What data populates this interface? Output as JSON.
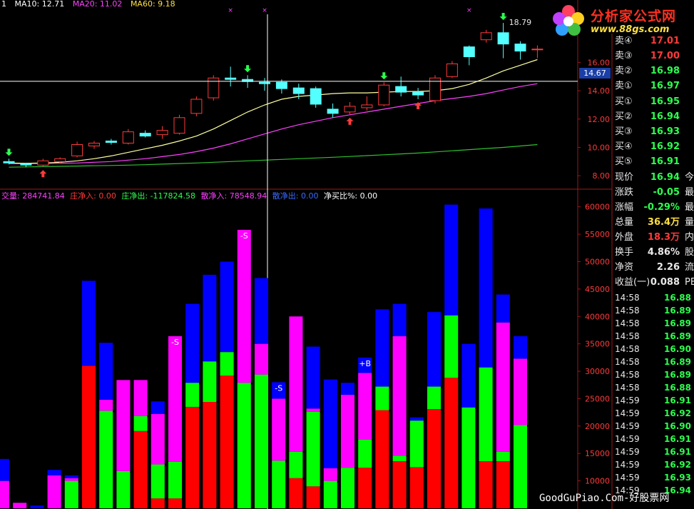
{
  "ma_legend": {
    "ma10": "MA10: 12.71",
    "ma20": "MA20: 11.02",
    "ma60": "MA60: 9.18",
    "lead": "1"
  },
  "vol_legend": {
    "total": "交量: 284741.84",
    "main_in": "庄净入: 0.00",
    "main_out": "庄净出: -117824.58",
    "retail_in": "散净入: 78548.94",
    "retail_out": "散净出: 0.00",
    "ratio": "净买比%: 0.00"
  },
  "logo": {
    "title": "分析家公式网",
    "url": "www.88gs.com"
  },
  "price_axis_labels": [
    "16.00",
    "14.00",
    "12.00",
    "10.00",
    "8.00"
  ],
  "volume_axis_labels": [
    "60000",
    "55000",
    "50000",
    "45000",
    "40000",
    "35000",
    "30000",
    "25000",
    "20000",
    "15000",
    "10000"
  ],
  "crosshair_price": "14.67",
  "high_label": "18.79",
  "order_book": [
    {
      "label": "卖④",
      "value": "17.01",
      "color": "#ff3a3a"
    },
    {
      "label": "卖③",
      "value": "17.00",
      "color": "#ff3a3a"
    },
    {
      "label": "卖②",
      "value": "16.98",
      "color": "#2dff4f"
    },
    {
      "label": "卖①",
      "value": "16.97",
      "color": "#2dff4f"
    },
    {
      "label": "买①",
      "value": "16.95",
      "color": "#2dff4f"
    },
    {
      "label": "买②",
      "value": "16.94",
      "color": "#2dff4f"
    },
    {
      "label": "买③",
      "value": "16.93",
      "color": "#2dff4f"
    },
    {
      "label": "买④",
      "value": "16.92",
      "color": "#2dff4f"
    },
    {
      "label": "买⑤",
      "value": "16.91",
      "color": "#2dff4f"
    }
  ],
  "quote_info": [
    {
      "label": "现价",
      "value": "16.94",
      "extra": "今",
      "color": "#2dff4f"
    },
    {
      "label": "涨跌",
      "value": "-0.05",
      "extra": "最",
      "color": "#2dff4f"
    },
    {
      "label": "涨幅",
      "value": "-0.29%",
      "extra": "最",
      "color": "#2dff4f"
    },
    {
      "label": "总量",
      "value": "36.4万",
      "extra": "量",
      "color": "#ffe040"
    },
    {
      "label": "外盘",
      "value": "18.3万",
      "extra": "内",
      "color": "#ff3a3a"
    },
    {
      "label": "换手",
      "value": "4.86%",
      "extra": "股",
      "color": "#e8e8e8"
    },
    {
      "label": "净资",
      "value": "2.26",
      "extra": "流",
      "color": "#e8e8e8"
    },
    {
      "label": "收益(一)",
      "value": "0.088",
      "extra": "PE",
      "color": "#e8e8e8"
    }
  ],
  "ticks": [
    {
      "time": "14:58",
      "price": "16.88"
    },
    {
      "time": "14:58",
      "price": "16.89"
    },
    {
      "time": "14:58",
      "price": "16.89"
    },
    {
      "time": "14:58",
      "price": "16.89"
    },
    {
      "time": "14:58",
      "price": "16.90"
    },
    {
      "time": "14:58",
      "price": "16.89"
    },
    {
      "time": "14:58",
      "price": "16.89"
    },
    {
      "time": "14:58",
      "price": "16.88"
    },
    {
      "time": "14:59",
      "price": "16.91"
    },
    {
      "time": "14:59",
      "price": "16.92"
    },
    {
      "time": "14:59",
      "price": "16.90"
    },
    {
      "time": "14:59",
      "price": "16.91"
    },
    {
      "time": "14:59",
      "price": "16.91"
    },
    {
      "time": "14:59",
      "price": "16.92"
    },
    {
      "time": "14:59",
      "price": "16.93"
    },
    {
      "time": "14:59",
      "price": "16.94"
    }
  ],
  "watermark": "GoodGuPiao.Com-好股票网",
  "chart_data": {
    "type": "bar",
    "price_panel": {
      "ylim": [
        7.2,
        19.4
      ],
      "crosshair_price": 14.67,
      "candles": [
        {
          "o": 9.0,
          "c": 8.9,
          "h": 9.2,
          "l": 8.8
        },
        {
          "o": 8.85,
          "c": 8.75,
          "h": 8.9,
          "l": 8.6
        },
        {
          "o": 8.75,
          "c": 9.05,
          "h": 9.2,
          "l": 8.6
        },
        {
          "o": 9.0,
          "c": 9.2,
          "h": 9.3,
          "l": 8.9
        },
        {
          "o": 9.4,
          "c": 10.2,
          "h": 10.4,
          "l": 9.3
        },
        {
          "o": 10.1,
          "c": 10.3,
          "h": 10.45,
          "l": 9.9
        },
        {
          "o": 10.45,
          "c": 10.35,
          "h": 10.6,
          "l": 10.2
        },
        {
          "o": 10.3,
          "c": 11.1,
          "h": 11.3,
          "l": 10.2
        },
        {
          "o": 11.0,
          "c": 10.8,
          "h": 11.2,
          "l": 10.7
        },
        {
          "o": 10.9,
          "c": 11.2,
          "h": 11.5,
          "l": 10.6
        },
        {
          "o": 11.0,
          "c": 12.1,
          "h": 12.3,
          "l": 10.9
        },
        {
          "o": 12.4,
          "c": 13.4,
          "h": 13.6,
          "l": 12.2
        },
        {
          "o": 13.5,
          "c": 14.9,
          "h": 15.1,
          "l": 13.3
        },
        {
          "o": 14.9,
          "c": 14.8,
          "h": 15.7,
          "l": 14.3
        },
        {
          "o": 14.8,
          "c": 14.65,
          "h": 15.1,
          "l": 14.2
        },
        {
          "o": 14.6,
          "c": 14.5,
          "h": 14.9,
          "l": 14.0
        },
        {
          "o": 14.6,
          "c": 14.15,
          "h": 14.8,
          "l": 13.8
        },
        {
          "o": 14.2,
          "c": 13.8,
          "h": 14.5,
          "l": 13.4
        },
        {
          "o": 14.15,
          "c": 13.05,
          "h": 14.3,
          "l": 12.8
        },
        {
          "o": 12.7,
          "c": 12.4,
          "h": 13.1,
          "l": 12.1
        },
        {
          "o": 12.5,
          "c": 12.9,
          "h": 13.2,
          "l": 12.3
        },
        {
          "o": 12.8,
          "c": 13.0,
          "h": 13.6,
          "l": 12.6
        },
        {
          "o": 13.0,
          "c": 14.4,
          "h": 14.6,
          "l": 12.9
        },
        {
          "o": 14.3,
          "c": 13.9,
          "h": 15.0,
          "l": 13.6
        },
        {
          "o": 13.9,
          "c": 13.7,
          "h": 14.2,
          "l": 13.4
        },
        {
          "o": 13.3,
          "c": 14.9,
          "h": 15.1,
          "l": 13.1
        },
        {
          "o": 15.0,
          "c": 15.9,
          "h": 16.1,
          "l": 14.9
        },
        {
          "o": 17.1,
          "c": 16.4,
          "h": 17.2,
          "l": 15.8
        },
        {
          "o": 17.6,
          "c": 18.1,
          "h": 18.3,
          "l": 17.4
        },
        {
          "o": 18.1,
          "c": 17.3,
          "h": 18.79,
          "l": 16.3
        },
        {
          "o": 17.3,
          "c": 16.8,
          "h": 17.5,
          "l": 16.2
        },
        {
          "o": 16.9,
          "c": 16.94,
          "h": 17.2,
          "l": 16.3
        }
      ],
      "ma10": [
        8.9,
        8.88,
        8.9,
        8.95,
        9.05,
        9.2,
        9.4,
        9.65,
        9.9,
        10.15,
        10.45,
        10.8,
        11.3,
        11.9,
        12.5,
        13.0,
        13.4,
        13.6,
        13.7,
        13.8,
        13.85,
        13.85,
        13.9,
        13.95,
        13.95,
        14.0,
        14.15,
        14.45,
        14.9,
        15.4,
        15.8,
        16.2
      ],
      "ma20": [
        8.85,
        8.86,
        8.87,
        8.88,
        8.9,
        8.95,
        9.0,
        9.1,
        9.2,
        9.35,
        9.5,
        9.7,
        9.95,
        10.25,
        10.6,
        10.95,
        11.3,
        11.6,
        11.85,
        12.1,
        12.3,
        12.5,
        12.7,
        12.9,
        13.1,
        13.3,
        13.45,
        13.6,
        13.8,
        14.05,
        14.3,
        14.5
      ],
      "ma60": [
        8.6,
        8.62,
        8.64,
        8.66,
        8.68,
        8.7,
        8.72,
        8.75,
        8.78,
        8.82,
        8.86,
        8.9,
        8.95,
        9.0,
        9.05,
        9.1,
        9.15,
        9.2,
        9.25,
        9.3,
        9.36,
        9.42,
        9.48,
        9.54,
        9.6,
        9.68,
        9.76,
        9.84,
        9.92,
        10.0,
        10.1,
        10.2
      ]
    },
    "volume_panel": {
      "ylim": [
        5000,
        61000
      ],
      "segments": [
        {
          "red": 0,
          "green": 0,
          "magenta": 10000,
          "blue": 14000
        },
        {
          "red": 0,
          "green": 0,
          "magenta": 6000,
          "blue": 6000
        },
        {
          "red": 0,
          "green": 0,
          "magenta": 0,
          "blue": 5500
        },
        {
          "red": 0,
          "green": 0,
          "magenta": 11000,
          "blue": 12000
        },
        {
          "red": 0,
          "green": 10000,
          "magenta": 10500,
          "blue": 11000
        },
        {
          "red": 31000,
          "green": 31000,
          "magenta": 31000,
          "blue": 46500
        },
        {
          "red": 0,
          "green": 22800,
          "magenta": 24800,
          "blue": 35200
        },
        {
          "red": 0,
          "green": 11800,
          "magenta": 28400,
          "blue": 28400
        },
        {
          "red": 19100,
          "green": 21800,
          "magenta": 28400,
          "blue": 28400
        },
        {
          "red": 6800,
          "green": 13000,
          "magenta": 22200,
          "blue": 24500
        },
        {
          "red": 6800,
          "green": 13500,
          "magenta": 36400,
          "blue": 36400
        },
        {
          "red": 23500,
          "green": 27900,
          "magenta": 27900,
          "blue": 42300
        },
        {
          "red": 24400,
          "green": 31800,
          "magenta": 31800,
          "blue": 47600
        },
        {
          "red": 29200,
          "green": 33500,
          "magenta": 33500,
          "blue": 50000
        },
        {
          "red": 0,
          "green": 27900,
          "magenta": 55800,
          "blue": 55800
        },
        {
          "red": 0,
          "green": 29400,
          "magenta": 35000,
          "blue": 47000
        },
        {
          "red": 0,
          "green": 13700,
          "magenta": 25000,
          "blue": 28000
        },
        {
          "red": 10500,
          "green": 15300,
          "magenta": 40000,
          "blue": 40000
        },
        {
          "red": 9000,
          "green": 22600,
          "magenta": 23200,
          "blue": 34500
        },
        {
          "red": 0,
          "green": 10000,
          "magenta": 12300,
          "blue": 28500
        },
        {
          "red": 0,
          "green": 12400,
          "magenta": 25700,
          "blue": 27900
        },
        {
          "red": 12400,
          "green": 17500,
          "magenta": 29700,
          "blue": 32500
        },
        {
          "red": 22900,
          "green": 27200,
          "magenta": 27200,
          "blue": 41300
        },
        {
          "red": 13600,
          "green": 14600,
          "magenta": 36400,
          "blue": 42300
        },
        {
          "red": 12500,
          "green": 21000,
          "magenta": 21000,
          "blue": 21600
        },
        {
          "red": 23100,
          "green": 27200,
          "magenta": 27200,
          "blue": 40800
        },
        {
          "red": 28800,
          "green": 40200,
          "magenta": 40200,
          "blue": 60400
        },
        {
          "red": 0,
          "green": 23400,
          "magenta": 23400,
          "blue": 35000
        },
        {
          "red": 13600,
          "green": 30700,
          "magenta": 30700,
          "blue": 59700
        },
        {
          "red": 13600,
          "green": 15300,
          "magenta": 38900,
          "blue": 44000
        },
        {
          "red": 0,
          "green": 20200,
          "magenta": 32300,
          "blue": 36400
        }
      ],
      "annotations": [
        {
          "bar": 10,
          "text": "-S"
        },
        {
          "bar": 14,
          "text": "-S"
        },
        {
          "bar": 16,
          "text": "-S"
        },
        {
          "bar": 21,
          "text": "+B"
        }
      ]
    }
  }
}
